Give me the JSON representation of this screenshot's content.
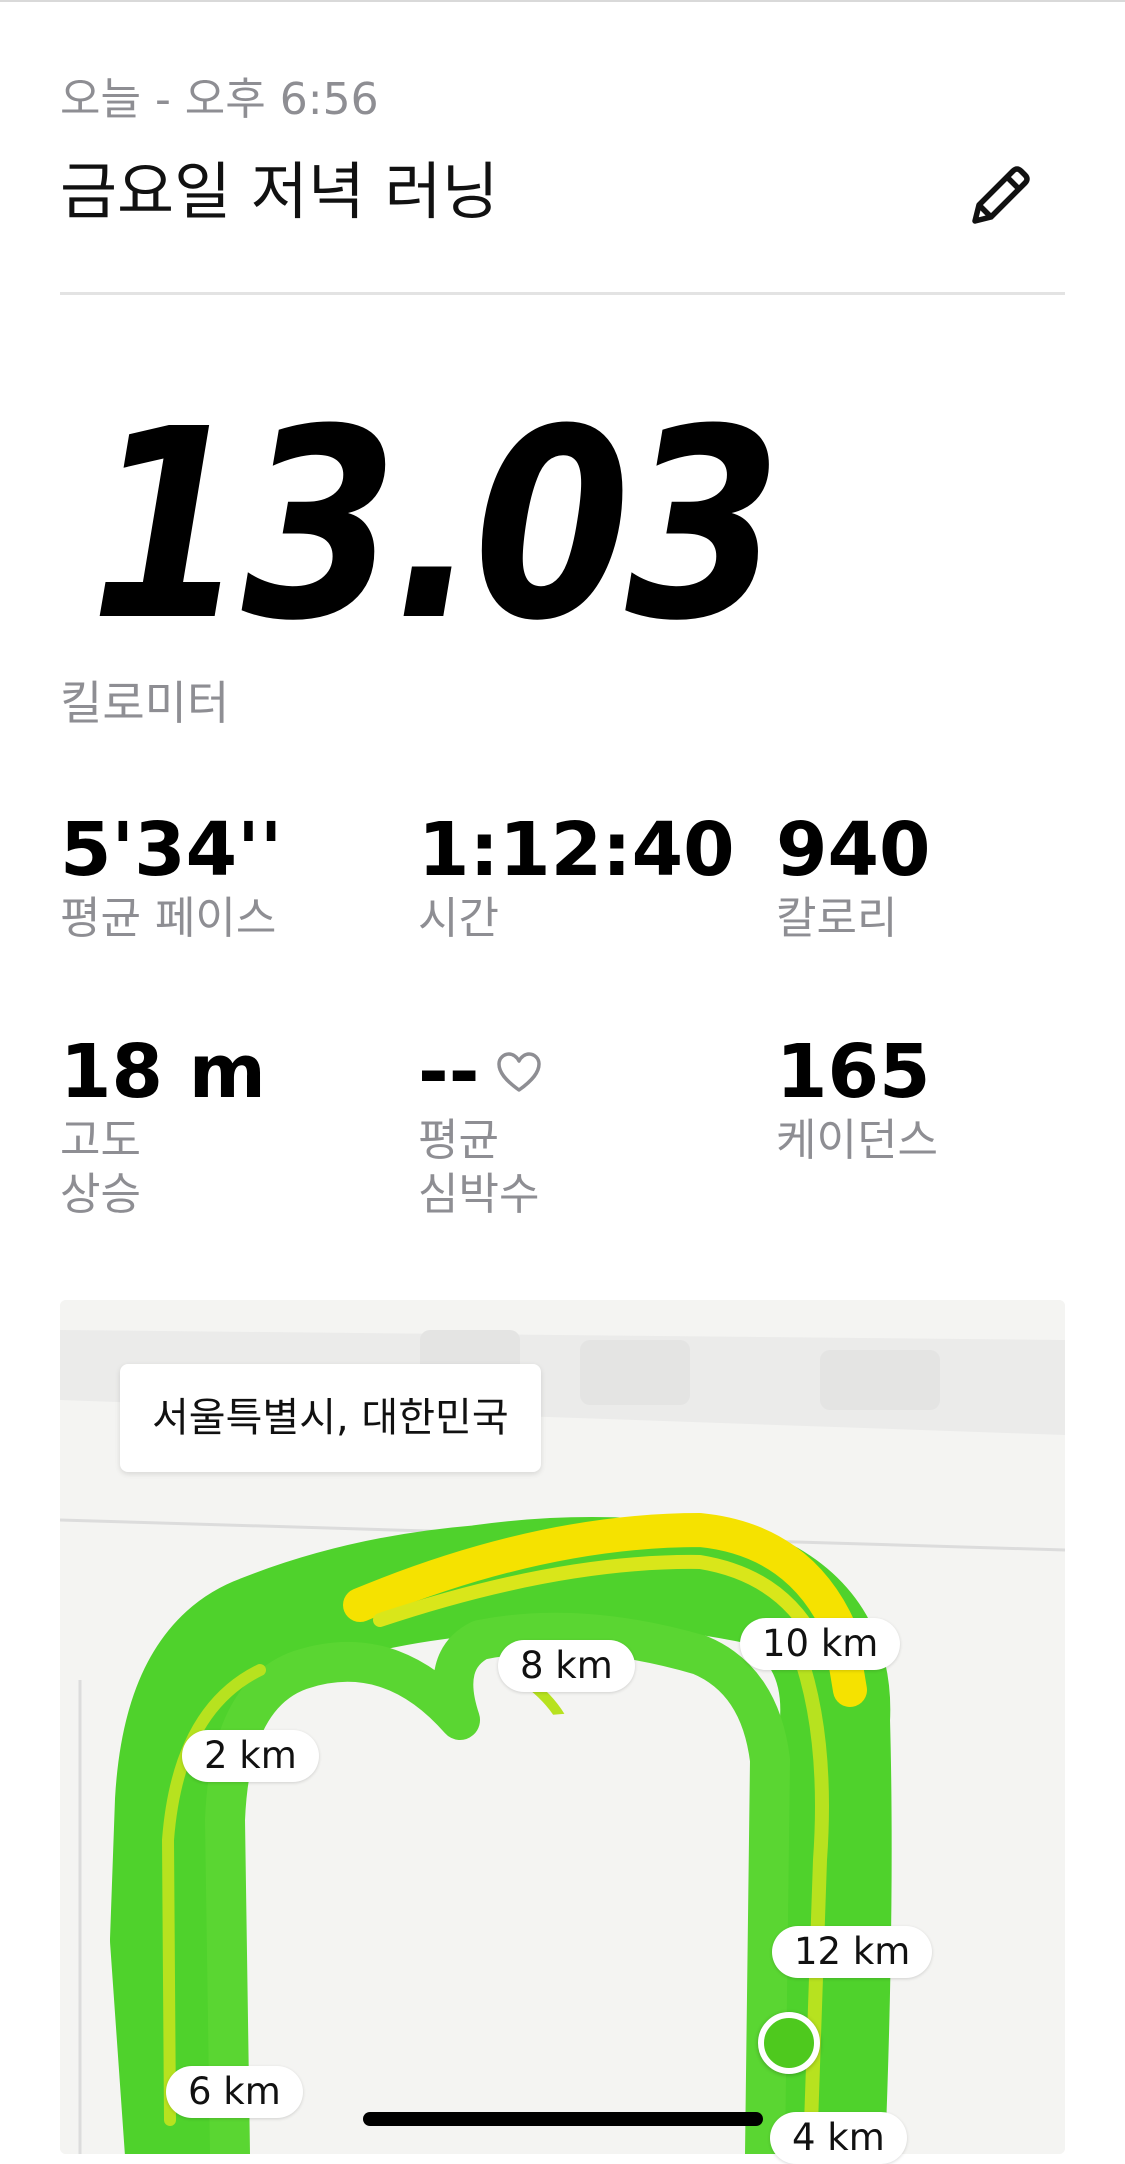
{
  "header": {
    "subtitle": "오늘 - 오후 6:56",
    "title": "금요일 저녁 러닝",
    "edit_icon": "pencil-icon"
  },
  "distance": {
    "value": "13.03",
    "unit": "킬로미터"
  },
  "stats": [
    {
      "value": "5'34''",
      "label": "평균 페이스"
    },
    {
      "value": "1:12:40",
      "label": "시간"
    },
    {
      "value": "940",
      "label": "칼로리"
    },
    {
      "value": "18 m",
      "label": "고도\n상승"
    },
    {
      "value": "--",
      "label": "평균\n심박수",
      "icon": "heart-icon"
    },
    {
      "value": "165",
      "label": "케이던스"
    }
  ],
  "map": {
    "location": "서울특별시, 대한민국",
    "markers": [
      "2 km",
      "4 km",
      "6 km",
      "8 km",
      "10 km",
      "12 km"
    ],
    "route_colors": {
      "fast": "#4fd22c",
      "mid": "#b7e21f",
      "slow": "#f5e200",
      "slowest": "#f02a12"
    }
  }
}
